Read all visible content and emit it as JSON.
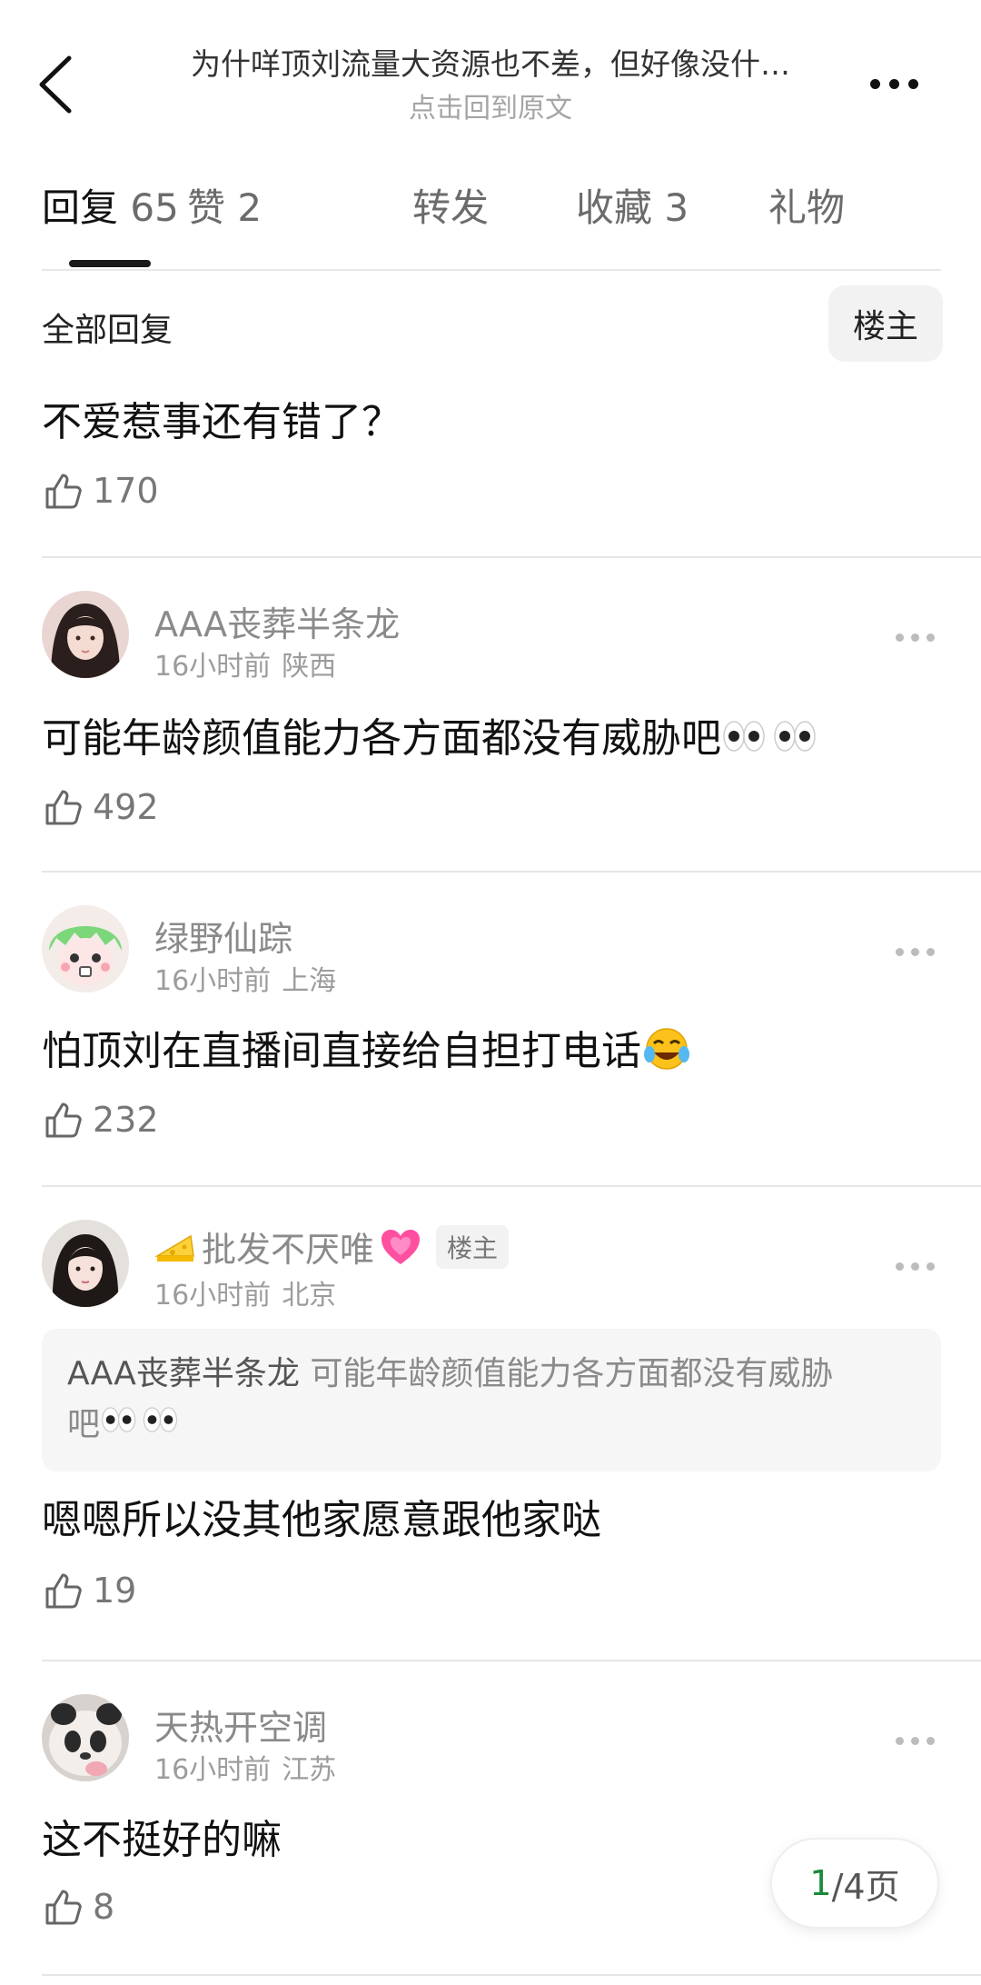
{
  "header": {
    "title": "为什咩顶刘流量大资源也不差，但好像没什…",
    "subtitle": "点击回到原文"
  },
  "tabs": [
    {
      "label": "回复",
      "count": "65"
    },
    {
      "label": "赞",
      "count": "2"
    },
    {
      "label": "转发",
      "count": ""
    },
    {
      "label": "收藏",
      "count": "3"
    },
    {
      "label": "礼物",
      "count": ""
    }
  ],
  "filter": {
    "all_label": "全部回复",
    "op_label": "楼主"
  },
  "post": {
    "text": "不爱惹事还有错了？",
    "likes": "170"
  },
  "comments": [
    {
      "username": "AAA丧葬半条龙",
      "time": "16小时前",
      "location": "陕西",
      "text": "可能年龄颜值能力各方面都没有威胁吧",
      "likes": "492"
    },
    {
      "username": "绿野仙踪",
      "time": "16小时前",
      "location": "上海",
      "text": "怕顶刘在直播间直接给自担打电话",
      "likes": "232"
    },
    {
      "username": "批发不厌唯",
      "badge": "楼主",
      "time": "16小时前",
      "location": "北京",
      "quote_user": "AAA丧葬半条龙",
      "quote_text_1": "可能年龄颜值能力各方面都没有威胁",
      "quote_text_2": "吧",
      "text": "嗯嗯所以没其他家愿意跟他家哒",
      "likes": "19"
    },
    {
      "username": "天热开空调",
      "time": "16小时前",
      "location": "江苏",
      "text": "这不挺好的嘛",
      "likes": "8"
    }
  ],
  "pager": {
    "current": "1",
    "total_text": "/4页"
  },
  "icons": {
    "back": "chevron-left-icon",
    "more": "more-horizontal-icon",
    "like": "thumbs-up-icon",
    "eyes": "eyes-emoji-icon",
    "laugh": "tears-of-joy-emoji-icon",
    "cheese": "cheese-emoji-icon",
    "heart": "heart-emoji-icon"
  },
  "colors": {
    "pager_current": "#1a8a3a",
    "meta_gray": "#9c9c9c"
  }
}
